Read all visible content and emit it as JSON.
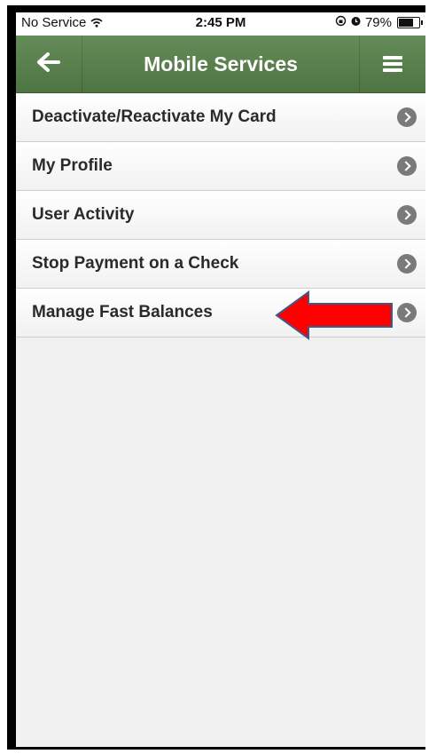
{
  "status_bar": {
    "carrier": "No Service",
    "time": "2:45 PM",
    "battery": "79%",
    "battery_level": 0.79
  },
  "nav": {
    "title": "Mobile Services"
  },
  "menu_items": [
    {
      "label": "Deactivate/Reactivate My Card"
    },
    {
      "label": "My Profile"
    },
    {
      "label": "User Activity"
    },
    {
      "label": "Stop Payment on a Check"
    },
    {
      "label": "Manage Fast Balances"
    }
  ],
  "annotation": {
    "color": "#ff0000",
    "points_to": "Manage Fast Balances"
  },
  "colors": {
    "nav_green": "#5a8250",
    "screen_bg": "#eff0ef"
  }
}
